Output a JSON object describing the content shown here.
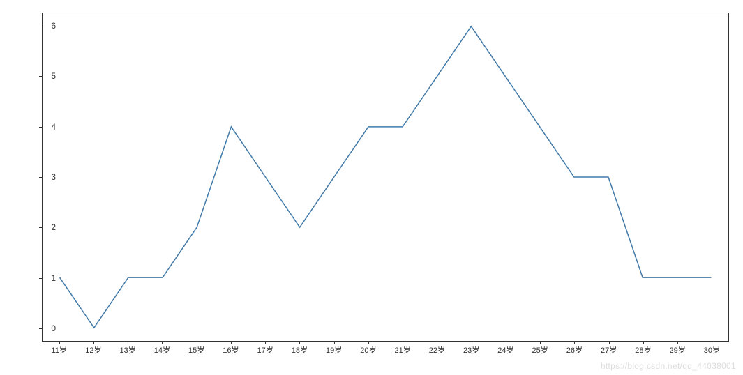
{
  "chart_data": {
    "type": "line",
    "categories": [
      "11",
      "12",
      "13",
      "14",
      "15",
      "16",
      "17",
      "18",
      "19",
      "20",
      "21",
      "22",
      "23",
      "24",
      "25",
      "26",
      "27",
      "28",
      "29",
      "30"
    ],
    "values": [
      1,
      0,
      1,
      1,
      2,
      4,
      3,
      2,
      3,
      4,
      4,
      5,
      6,
      5,
      4,
      3,
      3,
      1,
      1,
      1
    ],
    "title": "",
    "xlabel": "",
    "ylabel": "",
    "ylim": [
      0,
      6
    ],
    "y_ticks": [
      0,
      1,
      2,
      3,
      4,
      5,
      6
    ],
    "x_tick_suffix": "岁",
    "grid": false,
    "line_color": "#4179a8"
  },
  "watermark": "https://blog.csdn.net/qq_44038001"
}
